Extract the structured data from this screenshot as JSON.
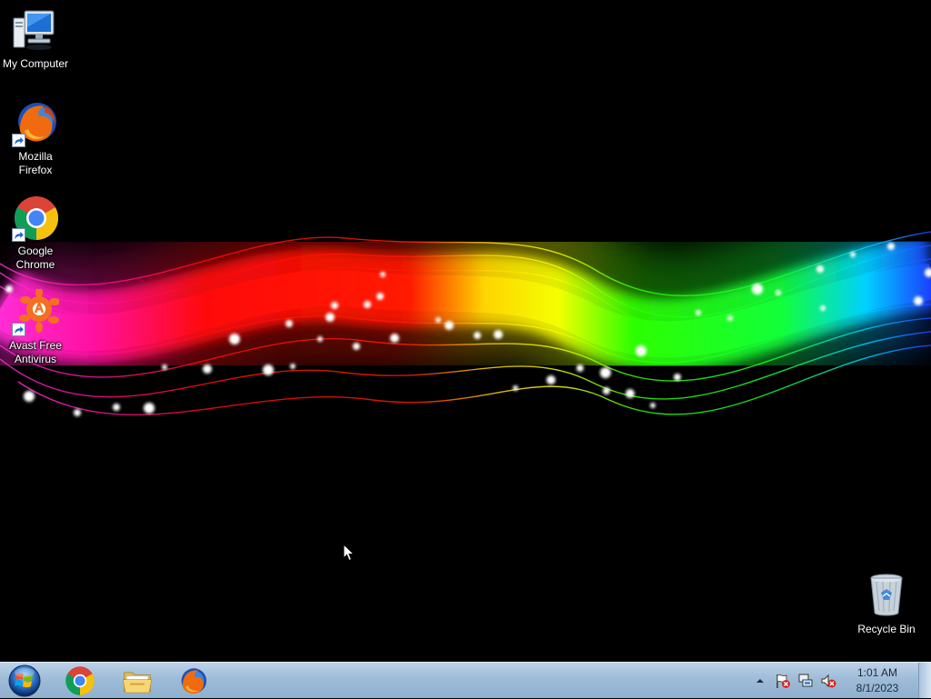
{
  "desktop": {
    "icons": [
      {
        "name": "my-computer",
        "label": "My Computer",
        "icon": "computer-icon",
        "shortcut": false
      },
      {
        "name": "mozilla-firefox",
        "label": "Mozilla\nFirefox",
        "icon": "firefox-icon",
        "shortcut": true
      },
      {
        "name": "google-chrome",
        "label": "Google\nChrome",
        "icon": "chrome-icon",
        "shortcut": true
      },
      {
        "name": "avast-free-antivirus",
        "label": "Avast Free\nAntivirus",
        "icon": "avast-icon",
        "shortcut": true
      },
      {
        "name": "recycle-bin",
        "label": "Recycle Bin",
        "icon": "recycle-bin-icon",
        "shortcut": false
      }
    ],
    "wallpaper": "rainbow-wave-wallpaper"
  },
  "taskbar": {
    "start_icon": "windows-start-orb-icon",
    "pinned": [
      {
        "name": "chrome",
        "icon": "chrome-icon"
      },
      {
        "name": "file-explorer",
        "icon": "folder-icon"
      },
      {
        "name": "firefox",
        "icon": "firefox-icon"
      }
    ],
    "tray": {
      "icons": [
        "show-hidden-icons-arrow-icon",
        "action-center-flag-icon",
        "network-icon",
        "volume-muted-icon"
      ],
      "time": "1:01 AM",
      "date": "8/1/2023"
    },
    "colors": {
      "bar_top": "#bcd2e8",
      "bar_bottom": "#8fb0d0"
    }
  }
}
